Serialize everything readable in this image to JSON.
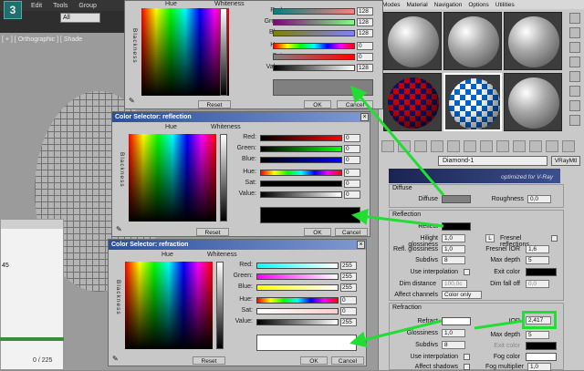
{
  "max": {
    "logo": "3",
    "menu": [
      "Edit",
      "Tools",
      "Group"
    ],
    "selection_filter": "All",
    "viewport_label": "[ + ] [ Orthographic ] [ Shade",
    "status_value": "45",
    "status_count": "0 / 225"
  },
  "material_editor": {
    "menu": [
      "Modes",
      "Material",
      "Navigation",
      "Options",
      "Utilities"
    ],
    "material_name": "Diamond-1",
    "material_type": "VRayMtl",
    "banner_text": "optimized for V-Ray",
    "diffuse": {
      "section": "Diffuse",
      "label": "Diffuse",
      "roughness_label": "Roughness",
      "roughness_value": "0,0"
    },
    "reflection": {
      "section": "Reflection",
      "reflect_label": "Reflect",
      "hilight_label": "Hilight glossiness",
      "hilight_value": "1,0",
      "l_label": "L",
      "fresnel_label": "Fresnel reflections",
      "refl_gloss_label": "Refl. glossiness",
      "refl_gloss_value": "1,0",
      "fresnel_ior_label": "Fresnel IOR",
      "fresnel_ior_value": "1,6",
      "subdivs_label": "Subdivs",
      "subdivs_value": "8",
      "max_depth_label": "Max depth",
      "max_depth_value": "5",
      "interp_label": "Use interpolation",
      "exit_color_label": "Exit color",
      "dim_dist_label": "Dim distance",
      "dim_dist_value": "100,0c",
      "dim_falloff_label": "Dim fall off",
      "dim_falloff_value": "0,0",
      "affect_label": "Affect channels",
      "affect_value": "Color only"
    },
    "refraction": {
      "section": "Refraction",
      "refract_label": "Refract",
      "ior_label": "IOR",
      "ior_value": "2,417",
      "gloss_label": "Glossiness",
      "gloss_value": "1,0",
      "max_depth_label": "Max depth",
      "max_depth_value": "5",
      "subdivs_label": "Subdivs",
      "subdivs_value": "8",
      "exit_color_label": "Exit color",
      "interp_label": "Use interpolation",
      "fog_color_label": "Fog color",
      "affect_shadows_label": "Affect shadows",
      "fog_mult_label": "Fog multiplier",
      "fog_mult_value": "1,0"
    }
  },
  "selectors": {
    "diffuse": {
      "hue": "Hue",
      "whiteness": "Whiteness",
      "blackness": "Blackness",
      "red_label": "Red:",
      "red": "128",
      "green_label": "Green:",
      "green": "128",
      "blue_label": "Blue:",
      "blue": "128",
      "hue_label": "Hue:",
      "hue_value": "0",
      "sat_label": "Sat:",
      "sat": "0",
      "value_label": "Value:",
      "value": "128",
      "reset": "Reset",
      "ok": "OK",
      "cancel": "Cancel",
      "preview_color": "#808080"
    },
    "reflection": {
      "title": "Color Selector: reflection",
      "hue": "Hue",
      "whiteness": "Whiteness",
      "blackness": "Blackness",
      "red_label": "Red:",
      "red": "0",
      "green_label": "Green:",
      "green": "0",
      "blue_label": "Blue:",
      "blue": "0",
      "hue_label": "Hue:",
      "hue_value": "0",
      "sat_label": "Sat:",
      "sat": "0",
      "value_label": "Value:",
      "value": "0",
      "reset": "Reset",
      "ok": "OK",
      "cancel": "Cancel",
      "preview_color": "#000000"
    },
    "refraction": {
      "title": "Color Selector: refraction",
      "hue": "Hue",
      "whiteness": "Whiteness",
      "blackness": "Blackness",
      "red_label": "Red:",
      "red": "255",
      "green_label": "Green:",
      "green": "255",
      "blue_label": "Blue:",
      "blue": "255",
      "hue_label": "Hue:",
      "hue_value": "0",
      "sat_label": "Sat:",
      "sat": "0",
      "value_label": "Value:",
      "value": "255",
      "reset": "Reset",
      "ok": "OK",
      "cancel": "Cancel",
      "preview_color": "#ffffff"
    }
  },
  "colors": {
    "arrow": "#22dd33",
    "highlight": "#22dd33",
    "title_bar": "#2b4f9b"
  }
}
